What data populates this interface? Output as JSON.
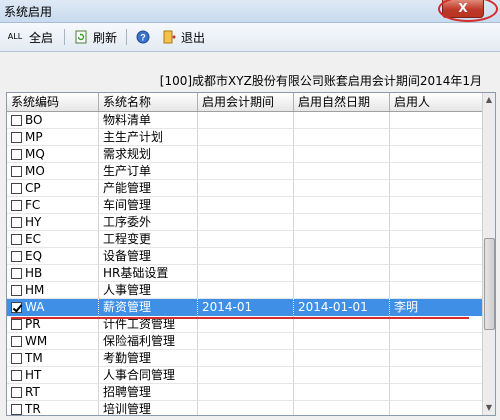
{
  "window": {
    "title": "系统启用",
    "close_label": "X"
  },
  "toolbar": {
    "select_all_label": "全启",
    "refresh_label": "刷新",
    "exit_label": "退出",
    "all_icon_text": "ALL"
  },
  "header_info": "[100]成都市XYZ股份有限公司账套启用会计期间2014年1月",
  "columns": [
    "系统编码",
    "系统名称",
    "启用会计期间",
    "启用自然日期",
    "启用人"
  ],
  "rows": [
    {
      "code": "BO",
      "name": "物料清单",
      "period": "",
      "date": "",
      "user": "",
      "checked": false
    },
    {
      "code": "MP",
      "name": "主生产计划",
      "period": "",
      "date": "",
      "user": "",
      "checked": false
    },
    {
      "code": "MQ",
      "name": "需求规划",
      "period": "",
      "date": "",
      "user": "",
      "checked": false
    },
    {
      "code": "MO",
      "name": "生产订单",
      "period": "",
      "date": "",
      "user": "",
      "checked": false
    },
    {
      "code": "CP",
      "name": "产能管理",
      "period": "",
      "date": "",
      "user": "",
      "checked": false
    },
    {
      "code": "FC",
      "name": "车间管理",
      "period": "",
      "date": "",
      "user": "",
      "checked": false
    },
    {
      "code": "HY",
      "name": "工序委外",
      "period": "",
      "date": "",
      "user": "",
      "checked": false
    },
    {
      "code": "EC",
      "name": "工程变更",
      "period": "",
      "date": "",
      "user": "",
      "checked": false
    },
    {
      "code": "EQ",
      "name": "设备管理",
      "period": "",
      "date": "",
      "user": "",
      "checked": false
    },
    {
      "code": "HB",
      "name": "HR基础设置",
      "period": "",
      "date": "",
      "user": "",
      "checked": false
    },
    {
      "code": "HM",
      "name": "人事管理",
      "period": "",
      "date": "",
      "user": "",
      "checked": false
    },
    {
      "code": "WA",
      "name": "薪资管理",
      "period": "2014-01",
      "date": "2014-01-01",
      "user": "李明",
      "checked": true,
      "selected": true
    },
    {
      "code": "PR",
      "name": "计件工资管理",
      "period": "",
      "date": "",
      "user": "",
      "checked": false
    },
    {
      "code": "WM",
      "name": "保险福利管理",
      "period": "",
      "date": "",
      "user": "",
      "checked": false
    },
    {
      "code": "TM",
      "name": "考勤管理",
      "period": "",
      "date": "",
      "user": "",
      "checked": false
    },
    {
      "code": "HT",
      "name": "人事合同管理",
      "period": "",
      "date": "",
      "user": "",
      "checked": false
    },
    {
      "code": "RT",
      "name": "招聘管理",
      "period": "",
      "date": "",
      "user": "",
      "checked": false
    },
    {
      "code": "TR",
      "name": "培训管理",
      "period": "",
      "date": "",
      "user": "",
      "checked": false
    }
  ],
  "colors": {
    "selected_row": "#3f8fe6",
    "annotation": "#d42b2b"
  }
}
